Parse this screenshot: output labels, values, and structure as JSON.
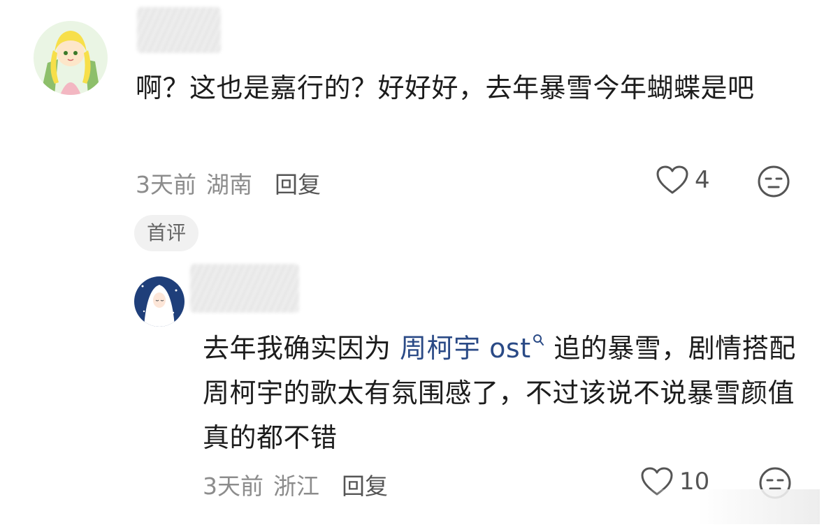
{
  "comments": [
    {
      "text": "啊？这也是嘉行的？好好好，去年暴雪今年蝴蝶是吧",
      "time": "3天前",
      "location": "湖南",
      "reply_label": "回复",
      "likes": "4"
    },
    {
      "badge": "首评",
      "text_before": "去年我确实因为 ",
      "topic": "周柯宇 ost",
      "topic_icon": "search-icon",
      "text_after": " 追的暴雪，剧情搭配周柯宇的歌太有氛围感了，不过该说不说暴雪颜值真的都不错",
      "time": "3天前",
      "location": "浙江",
      "reply_label": "回复",
      "likes": "10"
    }
  ],
  "colors": {
    "text": "#1c1c1c",
    "meta": "#8c8c8c",
    "link": "#2a4a86",
    "badge_bg": "#f1f1f1"
  }
}
